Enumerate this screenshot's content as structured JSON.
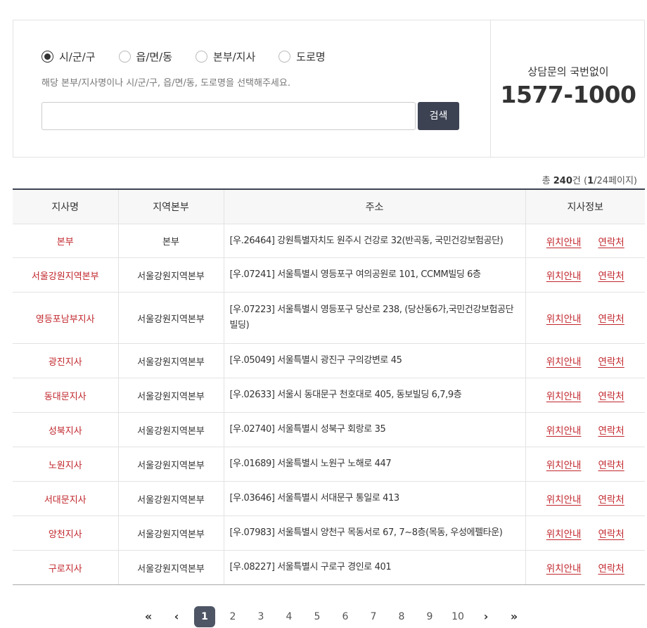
{
  "search": {
    "radios": [
      {
        "label": "시/군/구",
        "checked": true
      },
      {
        "label": "읍/면/동",
        "checked": false
      },
      {
        "label": "본부/지사",
        "checked": false
      },
      {
        "label": "도로명",
        "checked": false
      }
    ],
    "hint": "해당 본부/지사명이나 시/군/구, 읍/면/동, 도로명을 선택해주세요.",
    "input_value": "",
    "button_label": "검색"
  },
  "contact": {
    "label": "상담문의 국번없이",
    "number": "1577-1000"
  },
  "summary": {
    "prefix": "총 ",
    "total": "240",
    "mid": "건 (",
    "page": "1",
    "suffix": "/24페이지)"
  },
  "table": {
    "headers": [
      "지사명",
      "지역본부",
      "주소",
      "지사정보"
    ],
    "link_location": "위치안내",
    "link_contact": "연락처",
    "rows": [
      {
        "name": "본부",
        "region": "본부",
        "address": "[우.26464] 강원특별자치도 원주시 건강로 32(반곡동, 국민건강보험공단)"
      },
      {
        "name": "서울강원지역본부",
        "region": "서울강원지역본부",
        "address": "[우.07241] 서울특별시 영등포구 여의공원로 101, CCMM빌딩 6층"
      },
      {
        "name": "영등포남부지사",
        "region": "서울강원지역본부",
        "address": "[우.07223] 서울특별시 영등포구 당산로 238, (당산동6가,국민건강보험공단빌딩)"
      },
      {
        "name": "광진지사",
        "region": "서울강원지역본부",
        "address": "[우.05049] 서울특별시 광진구 구의강변로 45"
      },
      {
        "name": "동대문지사",
        "region": "서울강원지역본부",
        "address": "[우.02633] 서울시 동대문구 천호대로 405, 동보빌딩 6,7,9층"
      },
      {
        "name": "성북지사",
        "region": "서울강원지역본부",
        "address": "[우.02740] 서울특별시 성북구 회랑로 35"
      },
      {
        "name": "노원지사",
        "region": "서울강원지역본부",
        "address": "[우.01689] 서울특별시 노원구 노해로 447"
      },
      {
        "name": "서대문지사",
        "region": "서울강원지역본부",
        "address": "[우.03646] 서울특별시 서대문구 통일로 413"
      },
      {
        "name": "양천지사",
        "region": "서울강원지역본부",
        "address": "[우.07983] 서울특별시 양천구 목동서로 67, 7~8층(목동, 우성에펠타운)"
      },
      {
        "name": "구로지사",
        "region": "서울강원지역본부",
        "address": "[우.08227] 서울특별시 구로구 경인로 401"
      }
    ]
  },
  "pagination": {
    "first": "«",
    "prev": "‹",
    "pages": [
      "1",
      "2",
      "3",
      "4",
      "5",
      "6",
      "7",
      "8",
      "9",
      "10"
    ],
    "current": "1",
    "next": "›",
    "last": "»"
  },
  "colors": {
    "accent": "#c1272d",
    "dark": "#3d4253"
  }
}
